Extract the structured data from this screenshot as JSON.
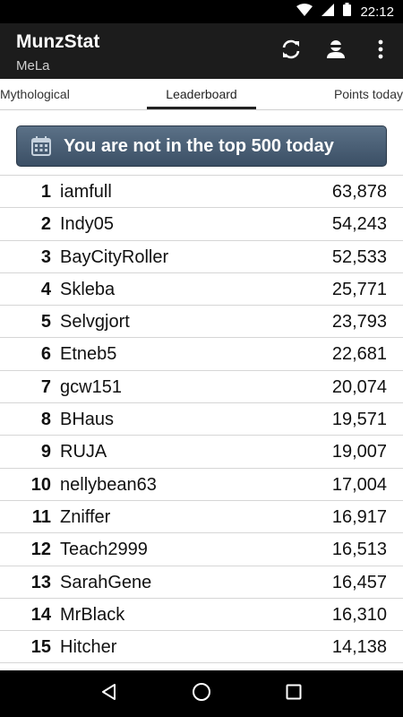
{
  "status": {
    "time": "22:12"
  },
  "app": {
    "title": "MunzStat",
    "subtitle": "MeLa"
  },
  "icons": {
    "refresh": "refresh-icon",
    "account": "account-icon",
    "overflow": "more-vert-icon",
    "calendar": "calendar-icon"
  },
  "tabs": [
    {
      "label": "Mythological",
      "selected": false
    },
    {
      "label": "Leaderboard",
      "selected": true
    },
    {
      "label": "Points today",
      "selected": false
    }
  ],
  "banner": {
    "text": "You are not in the top 500 today"
  },
  "leaderboard": [
    {
      "rank": "1",
      "name": "iamfull",
      "points": "63,878"
    },
    {
      "rank": "2",
      "name": "Indy05",
      "points": "54,243"
    },
    {
      "rank": "3",
      "name": "BayCityRoller",
      "points": "52,533"
    },
    {
      "rank": "4",
      "name": "Skleba",
      "points": "25,771"
    },
    {
      "rank": "5",
      "name": "Selvgjort",
      "points": "23,793"
    },
    {
      "rank": "6",
      "name": "Etneb5",
      "points": "22,681"
    },
    {
      "rank": "7",
      "name": "gcw151",
      "points": "20,074"
    },
    {
      "rank": "8",
      "name": "BHaus",
      "points": "19,571"
    },
    {
      "rank": "9",
      "name": "RUJA",
      "points": "19,007"
    },
    {
      "rank": "10",
      "name": "nellybean63",
      "points": "17,004"
    },
    {
      "rank": "11",
      "name": "Zniffer",
      "points": "16,917"
    },
    {
      "rank": "12",
      "name": "Teach2999",
      "points": "16,513"
    },
    {
      "rank": "13",
      "name": "SarahGene",
      "points": "16,457"
    },
    {
      "rank": "14",
      "name": "MrBlack",
      "points": "16,310"
    },
    {
      "rank": "15",
      "name": "Hitcher",
      "points": "14,138"
    }
  ],
  "colors": {
    "banner": "#4a6076",
    "app_bar": "#1c1c1c",
    "status_bar": "#000000"
  }
}
